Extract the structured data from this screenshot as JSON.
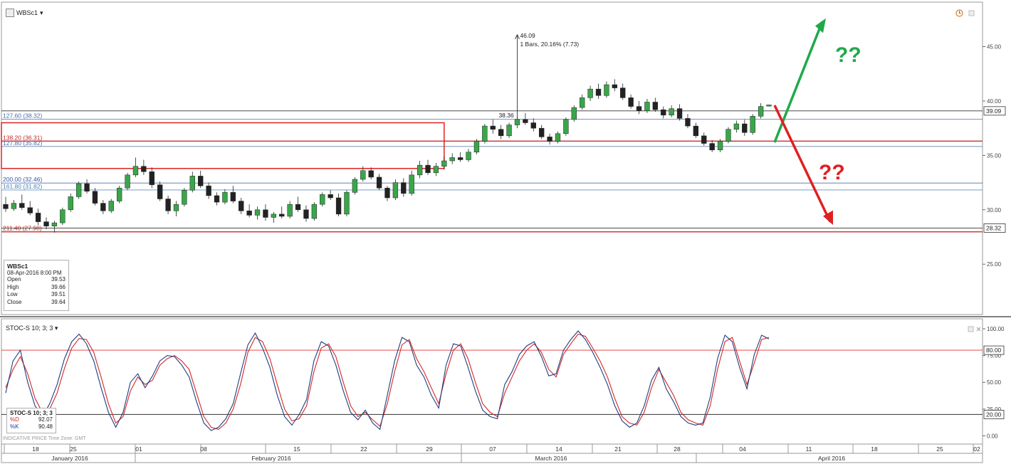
{
  "instrument": {
    "symbol": "WBSc1",
    "menu_glyph": "▾"
  },
  "info_box": {
    "symbol": "WBSc1",
    "datetime": "08-Apr-2016 8:00 PM",
    "rows": [
      {
        "label": "Open",
        "value": "39.53"
      },
      {
        "label": "High",
        "value": "39.66"
      },
      {
        "label": "Low",
        "value": "39.51"
      },
      {
        "label": "Close",
        "value": "39.64"
      }
    ]
  },
  "stoc_header": "STOC-S 10; 3; 3",
  "stoc_box": {
    "title": "STOC-S 10; 3; 3",
    "rows": [
      {
        "label": "%D",
        "value": "92.07",
        "color": "#d62728"
      },
      {
        "label": "%K",
        "value": "90.48",
        "color": "#1f3f7f"
      }
    ]
  },
  "indicative_text": "INDICATIVE PRICE   Time Zone: GMT",
  "chart_data": [
    {
      "type": "candlestick",
      "ylim": [
        20.5,
        48.5
      ],
      "yticks": [
        "45.00",
        "40.00",
        "35.00",
        "30.00",
        "25.00"
      ],
      "ytick_values": [
        45,
        40,
        35,
        30,
        25
      ],
      "last_price_tag": {
        "value": 39.09,
        "label": "39.09"
      },
      "low_tag": {
        "value": 28.32,
        "label": "28.32"
      },
      "fib_levels": [
        {
          "label": "127.60 (38.32)",
          "value": 38.32,
          "color": "#4a6fa5"
        },
        {
          "label": "138.20 (36.31)",
          "value": 36.31,
          "color": "#c62828"
        },
        {
          "label": "127.80 (35.82)",
          "value": 35.82,
          "color": "#4a6fa5"
        },
        {
          "label": "200.00 (32.46)",
          "value": 32.46,
          "color": "#3355aa"
        },
        {
          "label": "161.80 (31.82)",
          "value": 31.82,
          "color": "#4a7fb5"
        },
        {
          "label": "211.40 (27.98)",
          "value": 27.98,
          "color": "#c62828"
        }
      ],
      "measure_annotation": {
        "top_label": "46.09",
        "detail_label": "1 Bars, 20.16% (7.73)",
        "base_label": "38.36",
        "top_value": 46.09,
        "base_value": 38.36
      },
      "question_marks": [
        {
          "text": "??",
          "color": "#1faa4a"
        },
        {
          "text": "??",
          "color": "#e02020"
        }
      ],
      "bars": [
        {
          "o": 30.5,
          "h": 31.2,
          "l": 29.8,
          "c": 30.1
        },
        {
          "o": 30.1,
          "h": 30.9,
          "l": 29.9,
          "c": 30.6
        },
        {
          "o": 30.6,
          "h": 31.4,
          "l": 30.0,
          "c": 30.2
        },
        {
          "o": 30.2,
          "h": 30.8,
          "l": 29.5,
          "c": 29.7
        },
        {
          "o": 29.7,
          "h": 30.1,
          "l": 28.6,
          "c": 28.9
        },
        {
          "o": 28.9,
          "h": 29.3,
          "l": 28.2,
          "c": 28.5
        },
        {
          "o": 28.5,
          "h": 29.0,
          "l": 27.9,
          "c": 28.8
        },
        {
          "o": 28.8,
          "h": 30.2,
          "l": 28.6,
          "c": 30.0
        },
        {
          "o": 30.0,
          "h": 31.5,
          "l": 29.8,
          "c": 31.2
        },
        {
          "o": 31.2,
          "h": 32.6,
          "l": 31.0,
          "c": 32.4
        },
        {
          "o": 32.4,
          "h": 32.8,
          "l": 31.5,
          "c": 31.7
        },
        {
          "o": 31.7,
          "h": 32.0,
          "l": 30.4,
          "c": 30.6
        },
        {
          "o": 30.6,
          "h": 30.9,
          "l": 29.6,
          "c": 29.9
        },
        {
          "o": 29.9,
          "h": 31.0,
          "l": 29.7,
          "c": 30.8
        },
        {
          "o": 30.8,
          "h": 32.2,
          "l": 30.6,
          "c": 32.0
        },
        {
          "o": 32.0,
          "h": 33.4,
          "l": 31.8,
          "c": 33.2
        },
        {
          "o": 33.2,
          "h": 34.8,
          "l": 33.0,
          "c": 34.0
        },
        {
          "o": 34.0,
          "h": 34.6,
          "l": 33.2,
          "c": 33.5
        },
        {
          "o": 33.5,
          "h": 33.9,
          "l": 32.0,
          "c": 32.3
        },
        {
          "o": 32.3,
          "h": 32.6,
          "l": 30.8,
          "c": 31.0
        },
        {
          "o": 31.0,
          "h": 31.3,
          "l": 29.6,
          "c": 29.9
        },
        {
          "o": 29.9,
          "h": 30.8,
          "l": 29.4,
          "c": 30.5
        },
        {
          "o": 30.5,
          "h": 32.0,
          "l": 30.3,
          "c": 31.8
        },
        {
          "o": 31.8,
          "h": 33.5,
          "l": 31.6,
          "c": 33.1
        },
        {
          "o": 33.1,
          "h": 33.6,
          "l": 32.0,
          "c": 32.2
        },
        {
          "o": 32.2,
          "h": 32.5,
          "l": 31.0,
          "c": 31.3
        },
        {
          "o": 31.3,
          "h": 31.6,
          "l": 30.4,
          "c": 30.7
        },
        {
          "o": 30.7,
          "h": 31.9,
          "l": 30.5,
          "c": 31.6
        },
        {
          "o": 31.6,
          "h": 32.2,
          "l": 30.6,
          "c": 30.8
        },
        {
          "o": 30.8,
          "h": 31.1,
          "l": 29.6,
          "c": 29.9
        },
        {
          "o": 29.9,
          "h": 30.5,
          "l": 29.3,
          "c": 29.5
        },
        {
          "o": 29.5,
          "h": 30.3,
          "l": 29.1,
          "c": 30.0
        },
        {
          "o": 30.0,
          "h": 30.5,
          "l": 29.0,
          "c": 29.3
        },
        {
          "o": 29.3,
          "h": 29.8,
          "l": 28.8,
          "c": 29.6
        },
        {
          "o": 29.6,
          "h": 30.3,
          "l": 29.2,
          "c": 29.4
        },
        {
          "o": 29.4,
          "h": 30.8,
          "l": 29.2,
          "c": 30.5
        },
        {
          "o": 30.5,
          "h": 31.2,
          "l": 29.8,
          "c": 30.0
        },
        {
          "o": 30.0,
          "h": 30.4,
          "l": 28.9,
          "c": 29.2
        },
        {
          "o": 29.2,
          "h": 30.7,
          "l": 29.0,
          "c": 30.5
        },
        {
          "o": 30.5,
          "h": 31.6,
          "l": 30.3,
          "c": 31.4
        },
        {
          "o": 31.4,
          "h": 31.8,
          "l": 30.9,
          "c": 31.1
        },
        {
          "o": 31.1,
          "h": 31.5,
          "l": 29.4,
          "c": 29.6
        },
        {
          "o": 29.6,
          "h": 31.8,
          "l": 29.4,
          "c": 31.6
        },
        {
          "o": 31.6,
          "h": 33.0,
          "l": 31.4,
          "c": 32.8
        },
        {
          "o": 32.8,
          "h": 34.0,
          "l": 32.6,
          "c": 33.6
        },
        {
          "o": 33.6,
          "h": 33.9,
          "l": 32.8,
          "c": 33.0
        },
        {
          "o": 33.0,
          "h": 33.3,
          "l": 31.8,
          "c": 32.0
        },
        {
          "o": 32.0,
          "h": 32.2,
          "l": 30.8,
          "c": 31.1
        },
        {
          "o": 31.1,
          "h": 32.8,
          "l": 30.9,
          "c": 32.5
        },
        {
          "o": 32.5,
          "h": 32.9,
          "l": 31.2,
          "c": 31.5
        },
        {
          "o": 31.5,
          "h": 33.6,
          "l": 31.3,
          "c": 33.2
        },
        {
          "o": 33.2,
          "h": 34.5,
          "l": 32.9,
          "c": 34.1
        },
        {
          "o": 34.1,
          "h": 34.6,
          "l": 33.2,
          "c": 33.4
        },
        {
          "o": 33.4,
          "h": 34.3,
          "l": 33.1,
          "c": 34.0
        },
        {
          "o": 34.0,
          "h": 34.9,
          "l": 33.7,
          "c": 34.5
        },
        {
          "o": 34.5,
          "h": 35.2,
          "l": 34.2,
          "c": 34.8
        },
        {
          "o": 34.8,
          "h": 35.3,
          "l": 34.4,
          "c": 34.6
        },
        {
          "o": 34.6,
          "h": 35.6,
          "l": 34.4,
          "c": 35.3
        },
        {
          "o": 35.3,
          "h": 36.5,
          "l": 35.1,
          "c": 36.3
        },
        {
          "o": 36.3,
          "h": 37.9,
          "l": 36.1,
          "c": 37.7
        },
        {
          "o": 37.7,
          "h": 38.3,
          "l": 37.0,
          "c": 37.4
        },
        {
          "o": 37.4,
          "h": 37.8,
          "l": 36.5,
          "c": 36.8
        },
        {
          "o": 36.8,
          "h": 38.0,
          "l": 36.6,
          "c": 37.8
        },
        {
          "o": 37.8,
          "h": 38.6,
          "l": 37.5,
          "c": 38.3
        },
        {
          "o": 38.3,
          "h": 38.9,
          "l": 37.8,
          "c": 38.0
        },
        {
          "o": 38.0,
          "h": 38.4,
          "l": 37.2,
          "c": 37.5
        },
        {
          "o": 37.5,
          "h": 37.8,
          "l": 36.5,
          "c": 36.7
        },
        {
          "o": 36.7,
          "h": 37.0,
          "l": 36.0,
          "c": 36.3
        },
        {
          "o": 36.3,
          "h": 37.2,
          "l": 36.1,
          "c": 37.0
        },
        {
          "o": 37.0,
          "h": 38.5,
          "l": 36.8,
          "c": 38.3
        },
        {
          "o": 38.3,
          "h": 39.6,
          "l": 38.1,
          "c": 39.4
        },
        {
          "o": 39.4,
          "h": 40.6,
          "l": 39.2,
          "c": 40.3
        },
        {
          "o": 40.3,
          "h": 41.4,
          "l": 40.0,
          "c": 41.1
        },
        {
          "o": 41.1,
          "h": 41.6,
          "l": 40.2,
          "c": 40.5
        },
        {
          "o": 40.5,
          "h": 41.8,
          "l": 40.3,
          "c": 41.5
        },
        {
          "o": 41.5,
          "h": 42.0,
          "l": 40.9,
          "c": 41.2
        },
        {
          "o": 41.2,
          "h": 41.6,
          "l": 40.1,
          "c": 40.3
        },
        {
          "o": 40.3,
          "h": 40.6,
          "l": 39.3,
          "c": 39.5
        },
        {
          "o": 39.5,
          "h": 40.0,
          "l": 38.8,
          "c": 39.1
        },
        {
          "o": 39.1,
          "h": 40.2,
          "l": 38.9,
          "c": 39.9
        },
        {
          "o": 39.9,
          "h": 40.3,
          "l": 39.0,
          "c": 39.2
        },
        {
          "o": 39.2,
          "h": 39.5,
          "l": 38.4,
          "c": 38.7
        },
        {
          "o": 38.7,
          "h": 39.6,
          "l": 38.5,
          "c": 39.3
        },
        {
          "o": 39.3,
          "h": 39.7,
          "l": 38.2,
          "c": 38.4
        },
        {
          "o": 38.4,
          "h": 38.8,
          "l": 37.5,
          "c": 37.7
        },
        {
          "o": 37.7,
          "h": 38.0,
          "l": 36.6,
          "c": 36.8
        },
        {
          "o": 36.8,
          "h": 37.1,
          "l": 35.9,
          "c": 36.1
        },
        {
          "o": 36.1,
          "h": 36.4,
          "l": 35.3,
          "c": 35.5
        },
        {
          "o": 35.5,
          "h": 36.5,
          "l": 35.3,
          "c": 36.3
        },
        {
          "o": 36.3,
          "h": 37.6,
          "l": 36.1,
          "c": 37.4
        },
        {
          "o": 37.4,
          "h": 38.2,
          "l": 37.1,
          "c": 37.9
        },
        {
          "o": 37.9,
          "h": 38.3,
          "l": 36.8,
          "c": 37.1
        },
        {
          "o": 37.1,
          "h": 38.8,
          "l": 36.9,
          "c": 38.6
        },
        {
          "o": 38.6,
          "h": 39.8,
          "l": 38.4,
          "c": 39.5
        },
        {
          "o": 39.53,
          "h": 39.66,
          "l": 39.51,
          "c": 39.64
        }
      ]
    },
    {
      "type": "line",
      "title": "STOC-S 10; 3; 3",
      "ylim": [
        -5,
        104
      ],
      "yticks": [
        "100.00",
        "75.00",
        "50.00",
        "25.00",
        "0.00"
      ],
      "ytick_values": [
        100,
        75,
        50,
        25,
        0
      ],
      "levels": [
        {
          "label": "80.00",
          "value": 80,
          "color": "#e03030"
        },
        {
          "label": "20.00",
          "value": 20,
          "color": "#333333"
        }
      ],
      "series": [
        {
          "name": "%D",
          "color": "#d62728",
          "values": [
            45,
            62,
            74,
            58,
            35,
            22,
            25,
            40,
            63,
            82,
            91,
            90,
            78,
            55,
            30,
            12,
            18,
            42,
            55,
            48,
            52,
            66,
            72,
            75,
            70,
            62,
            40,
            18,
            8,
            6,
            12,
            25,
            48,
            78,
            92,
            88,
            72,
            48,
            25,
            14,
            16,
            28,
            60,
            82,
            86,
            74,
            50,
            28,
            18,
            22,
            15,
            9,
            30,
            60,
            85,
            90,
            72,
            60,
            45,
            30,
            58,
            80,
            86,
            72,
            50,
            30,
            22,
            18,
            40,
            55,
            70,
            80,
            86,
            78,
            62,
            55,
            76,
            86,
            95,
            93,
            82,
            70,
            55,
            35,
            18,
            12,
            10,
            22,
            45,
            62,
            50,
            38,
            22,
            15,
            12,
            10,
            28,
            62,
            88,
            92,
            70,
            48,
            68,
            90,
            92
          ]
        },
        {
          "name": "%K",
          "color": "#1f3f7f",
          "values": [
            40,
            70,
            80,
            50,
            28,
            18,
            30,
            48,
            72,
            88,
            95,
            86,
            70,
            45,
            22,
            8,
            22,
            50,
            58,
            45,
            56,
            70,
            75,
            74,
            66,
            55,
            32,
            12,
            5,
            8,
            16,
            30,
            58,
            85,
            96,
            82,
            64,
            38,
            18,
            10,
            20,
            34,
            70,
            88,
            84,
            66,
            42,
            22,
            15,
            24,
            12,
            6,
            38,
            70,
            92,
            88,
            66,
            55,
            38,
            26,
            66,
            86,
            84,
            64,
            42,
            24,
            18,
            16,
            48,
            60,
            76,
            84,
            88,
            74,
            56,
            58,
            80,
            90,
            98,
            90,
            78,
            64,
            48,
            28,
            14,
            8,
            12,
            28,
            52,
            64,
            44,
            32,
            18,
            12,
            10,
            12,
            36,
            72,
            94,
            88,
            64,
            44,
            76,
            94,
            90.48
          ]
        }
      ]
    }
  ],
  "time_axis": {
    "day_labels": [
      "18",
      "25",
      "01",
      "08",
      "15",
      "22",
      "29",
      "07",
      "14",
      "21",
      "28",
      "04",
      "11",
      "18",
      "25",
      "02"
    ],
    "month_labels": [
      "January 2016",
      "February 2016",
      "March 2016",
      "April 2016"
    ]
  }
}
